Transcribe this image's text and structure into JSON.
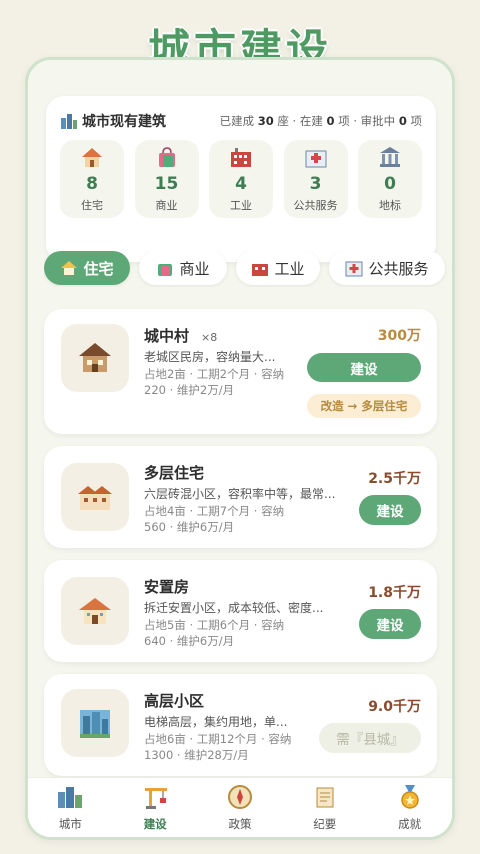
{
  "app_title": "城市建设",
  "summary": {
    "title": "城市现有建筑",
    "built_prefix": "已建成",
    "built_count": "30",
    "built_suffix": "座 · 在建",
    "building_count": "0",
    "building_suffix": "项 · 审批中",
    "approving_count": "0",
    "approving_suffix": "项",
    "stats": [
      {
        "icon": "house-icon",
        "value": "8",
        "label": "住宅"
      },
      {
        "icon": "shopping-bag-icon",
        "value": "15",
        "label": "商业"
      },
      {
        "icon": "factory-icon",
        "value": "4",
        "label": "工业"
      },
      {
        "icon": "hospital-icon",
        "value": "3",
        "label": "公共服务"
      },
      {
        "icon": "landmark-icon",
        "value": "0",
        "label": "地标"
      }
    ]
  },
  "tabs": [
    {
      "icon": "house-icon",
      "label": "住宅",
      "active": true
    },
    {
      "icon": "shopping-bag-icon",
      "label": "商业",
      "active": false
    },
    {
      "icon": "factory-icon",
      "label": "工业",
      "active": false
    },
    {
      "icon": "hospital-icon",
      "label": "公共服务",
      "active": false
    }
  ],
  "buildings": [
    {
      "name": "城中村",
      "count": "×8",
      "desc": "老城区民房，容纳量大...",
      "meta": "占地2亩 · 工期2个月 · 容纳220 · 维护2万/月",
      "price": "300万",
      "price_color": "#b98a3e",
      "button": "建设",
      "upgrade": "改造 → 多层住宅"
    },
    {
      "name": "多层住宅",
      "count": "",
      "desc": "六层砖混小区，容积率中等，最常...",
      "meta": "占地4亩 · 工期7个月 · 容纳560 · 维护6万/月",
      "price": "2.5千万",
      "price_color": "#8a4a2c",
      "button": "建设",
      "upgrade": ""
    },
    {
      "name": "安置房",
      "count": "",
      "desc": "拆迁安置小区，成本较低、密度...",
      "meta": "占地5亩 · 工期6个月 · 容纳640 · 维护6万/月",
      "price": "1.8千万",
      "price_color": "#8a4a2c",
      "button": "建设",
      "upgrade": ""
    },
    {
      "name": "高层小区",
      "count": "",
      "desc": "电梯高层，集约用地，单...",
      "meta": "占地6亩 · 工期12个月 · 容纳1300 · 维护28万/月",
      "price": "9.0千万",
      "price_color": "#8a4a2c",
      "button": "需『县城』",
      "upgrade": ""
    }
  ],
  "nav": [
    {
      "icon": "city-icon",
      "label": "城市",
      "active": false
    },
    {
      "icon": "crane-icon",
      "label": "建设",
      "active": true
    },
    {
      "icon": "compass-icon",
      "label": "政策",
      "active": false
    },
    {
      "icon": "scroll-icon",
      "label": "纪要",
      "active": false
    },
    {
      "icon": "medal-icon",
      "label": "成就",
      "active": false
    }
  ]
}
